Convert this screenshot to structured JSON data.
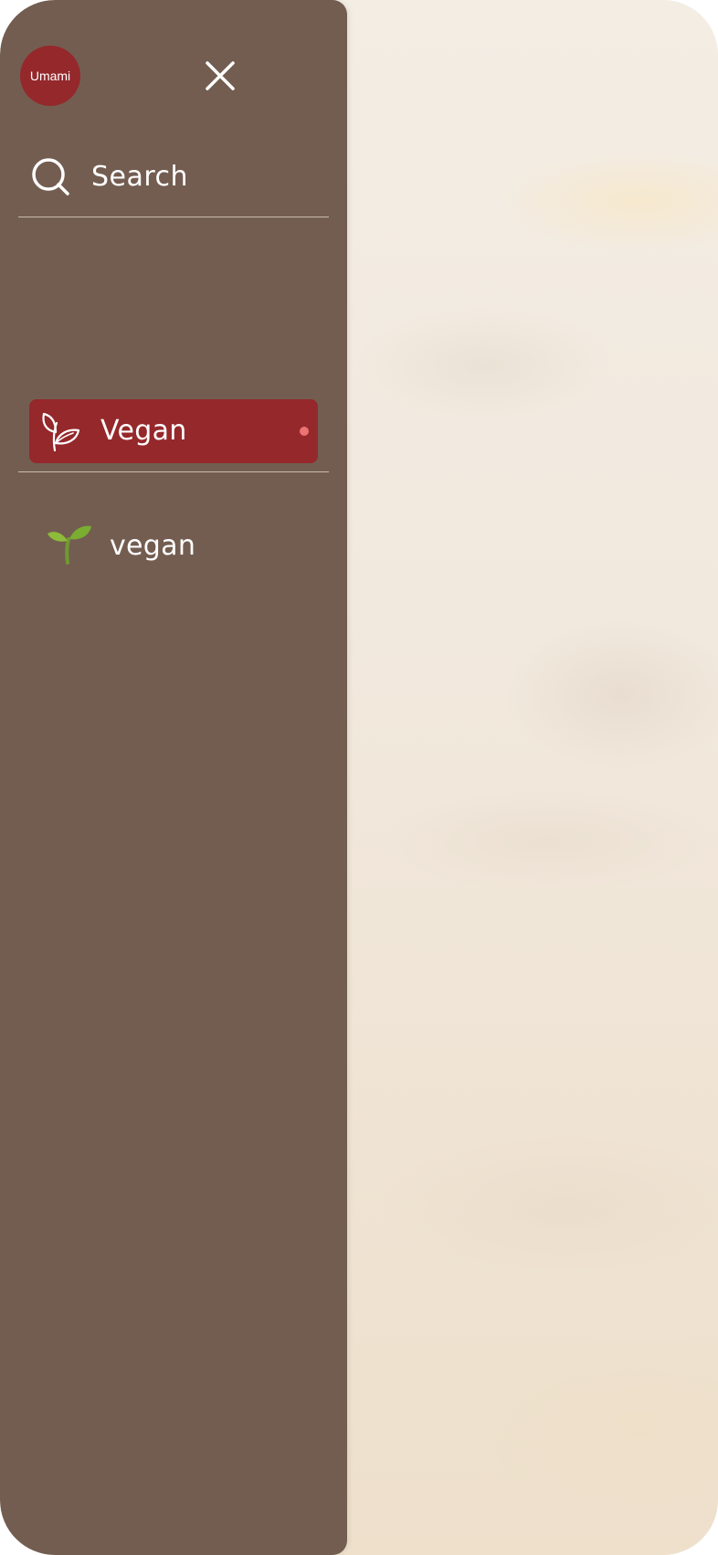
{
  "brand": {
    "logo_text": "Umami",
    "color": "#95282b"
  },
  "drawer": {
    "background": "#735d51",
    "close_icon": "close-icon",
    "search": {
      "icon": "search-icon",
      "label": "Search"
    },
    "items": [
      {
        "label": "Vegan",
        "icon": "leaf-icon",
        "active": true,
        "indicator_color": "#ec7373"
      },
      {
        "label": "vegan",
        "icon": "sprout-icon",
        "active": false
      }
    ]
  }
}
